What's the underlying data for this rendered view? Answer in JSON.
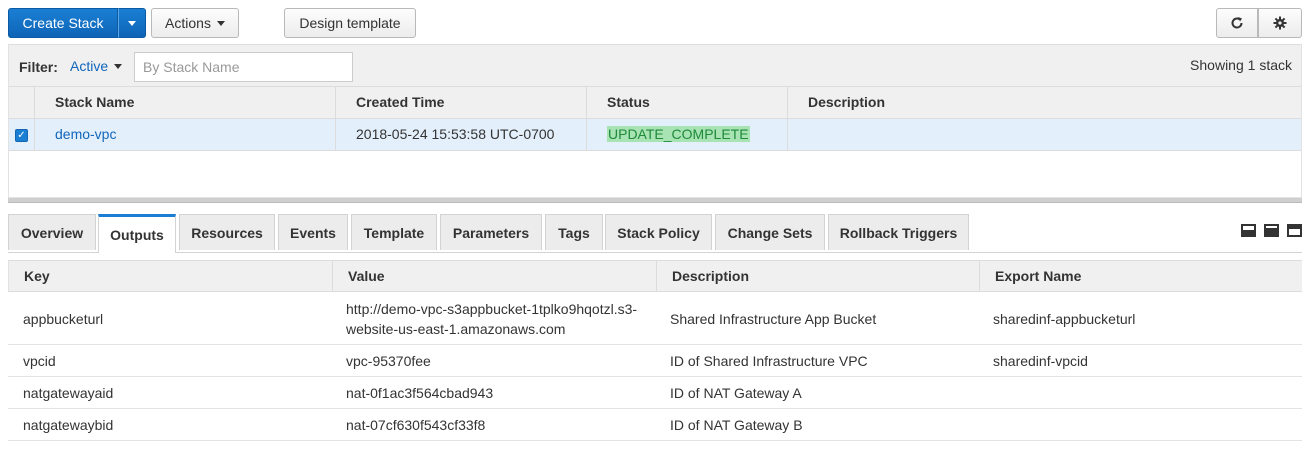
{
  "toolbar": {
    "create_stack_label": "Create Stack",
    "actions_label": "Actions",
    "design_template_label": "Design template",
    "refresh_icon": "refresh-icon",
    "settings_icon": "gear-icon"
  },
  "filter": {
    "label": "Filter:",
    "active_value": "Active",
    "search_placeholder": "By Stack Name",
    "showing_text": "Showing 1 stack"
  },
  "stack_table": {
    "columns": [
      "Stack Name",
      "Created Time",
      "Status",
      "Description"
    ],
    "rows": [
      {
        "selected": true,
        "name": "demo-vpc",
        "created": "2018-05-24 15:53:58 UTC-0700",
        "status": "UPDATE_COMPLETE",
        "description": ""
      }
    ]
  },
  "tabs": [
    {
      "label": "Overview",
      "active": false
    },
    {
      "label": "Outputs",
      "active": true
    },
    {
      "label": "Resources",
      "active": false
    },
    {
      "label": "Events",
      "active": false
    },
    {
      "label": "Template",
      "active": false
    },
    {
      "label": "Parameters",
      "active": false
    },
    {
      "label": "Tags",
      "active": false
    },
    {
      "label": "Stack Policy",
      "active": false
    },
    {
      "label": "Change Sets",
      "active": false
    },
    {
      "label": "Rollback Triggers",
      "active": false
    }
  ],
  "outputs": {
    "columns": [
      "Key",
      "Value",
      "Description",
      "Export Name"
    ],
    "rows": [
      {
        "key": "appbucketurl",
        "value": "http://demo-vpc-s3appbucket-1tplko9hqotzl.s3-website-us-east-1.amazonaws.com",
        "value_is_link": true,
        "description": "Shared Infrastructure App Bucket",
        "export": "sharedinf-appbucketurl"
      },
      {
        "key": "vpcid",
        "value": "vpc-95370fee",
        "value_is_link": false,
        "description": "ID of Shared Infrastructure VPC",
        "export": "sharedinf-vpcid"
      },
      {
        "key": "natgatewayaid",
        "value": "nat-0f1ac3f564cbad943",
        "value_is_link": false,
        "description": "ID of NAT Gateway A",
        "export": ""
      },
      {
        "key": "natgatewaybid",
        "value": "nat-07cf630f543cf33f8",
        "value_is_link": false,
        "description": "ID of NAT Gateway B",
        "export": ""
      }
    ]
  },
  "colors": {
    "primary": "#1a7fd4",
    "link": "#1166bb",
    "status_complete_bg": "#a7e3b3",
    "selected_row_bg": "#e3effa"
  }
}
